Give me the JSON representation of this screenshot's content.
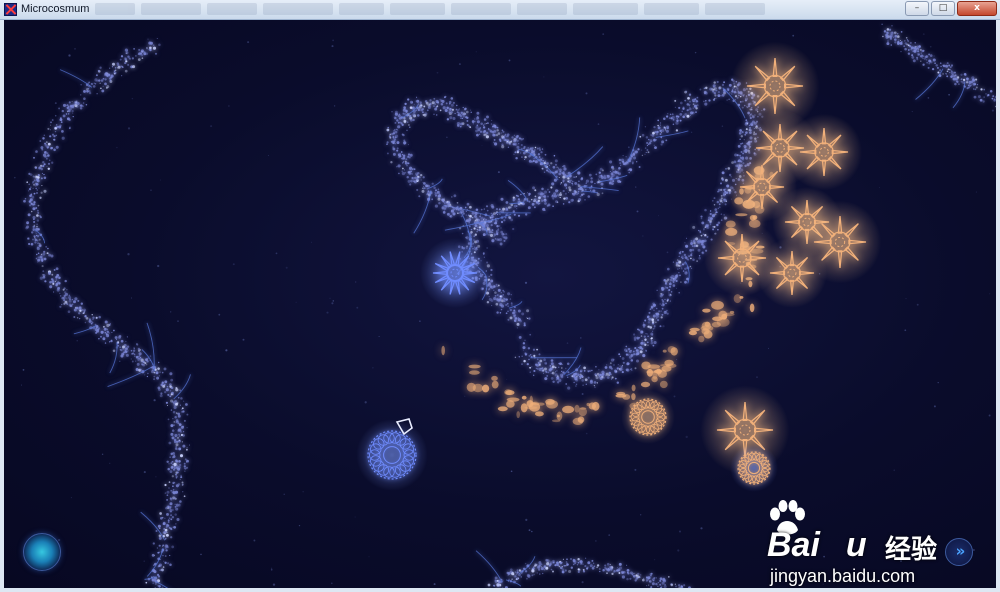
{
  "window": {
    "title": "Microcosmum",
    "app_icon": "app-icon",
    "controls": [
      {
        "name": "minimize",
        "glyph": "–"
      },
      {
        "name": "maximize",
        "glyph": "□"
      },
      {
        "name": "close",
        "glyph": "x"
      }
    ]
  },
  "game": {
    "colors": {
      "background": "#0b0d2a",
      "player_blue": "#6f8cff",
      "enemy_orange": "#f1b07a",
      "membrane": "#7b86d6"
    },
    "hud": {
      "menu_icon": "cell-menu-icon",
      "speed_icon": "fast-forward-icon",
      "speed_glyph": "»"
    }
  },
  "watermark": {
    "logo": "Bai",
    "logo_end": "u",
    "chinese": "经验",
    "url": "jingyan.baidu.com"
  }
}
